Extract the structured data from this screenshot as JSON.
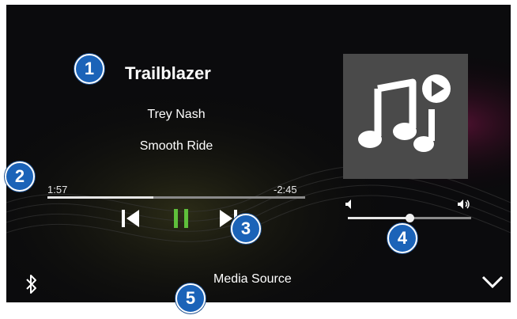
{
  "track": {
    "title": "Trailblazer",
    "artist": "Trey Nash",
    "album": "Smooth Ride",
    "elapsed": "1:57",
    "remaining": "-2:45",
    "progress_fraction": 0.41
  },
  "volume": {
    "level_fraction": 0.5
  },
  "footer": {
    "source_label": "Media Source"
  },
  "callouts": [
    "1",
    "2",
    "3",
    "4",
    "5"
  ],
  "icons": {
    "prev": "skip-previous-icon",
    "pause": "pause-icon",
    "next": "skip-next-icon",
    "volume_low": "volume-low-icon",
    "volume_high": "volume-high-icon",
    "bluetooth": "bluetooth-icon",
    "chevron": "chevron-down-icon",
    "album_art": "music-note-play-icon"
  },
  "colors": {
    "screen_bg": "#0b0b0d",
    "pause_accent": "#5fbf3b",
    "callout_blue": "#1b63b8",
    "album_art_bg": "#4a4a4a"
  }
}
